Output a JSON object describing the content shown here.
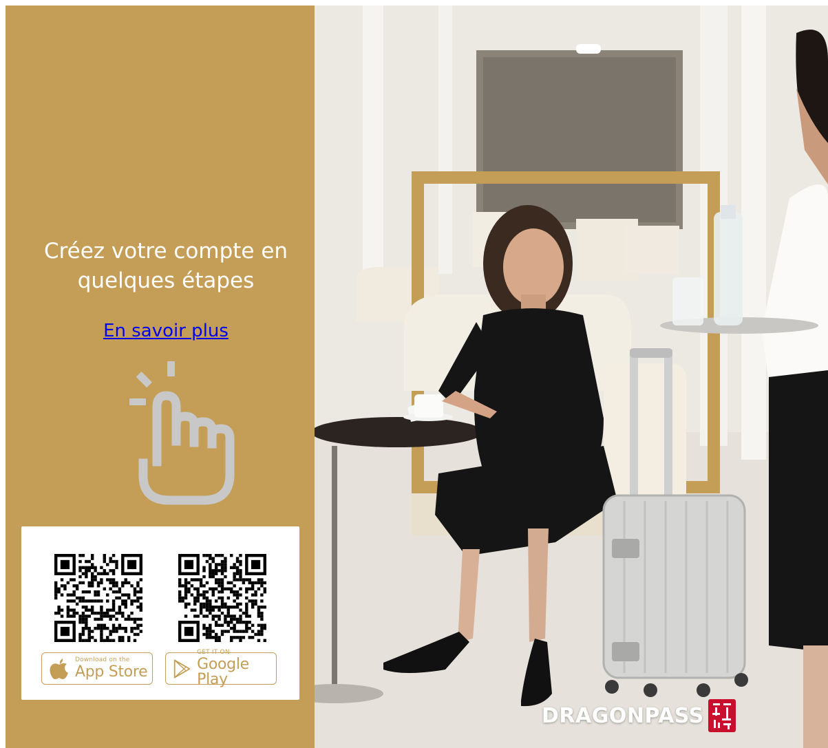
{
  "promo": {
    "headline_line1": "Créez votre compte  en",
    "headline_line2": "quelques étapes",
    "learn_more_link": "En savoir plus"
  },
  "apps": {
    "appstore_small": "Download on the",
    "appstore_big": "App Store",
    "playstore_small": "GET IT ON",
    "playstore_big": "Google Play"
  },
  "brand": {
    "name": "DRAGONPASS"
  },
  "colors": {
    "gold": "#c49e57",
    "icon_grey": "#c8c8c8",
    "seal_red": "#c8102e"
  },
  "icons": {
    "tap": "tap-hand-icon",
    "apple": "apple-icon",
    "play": "google-play-icon"
  }
}
